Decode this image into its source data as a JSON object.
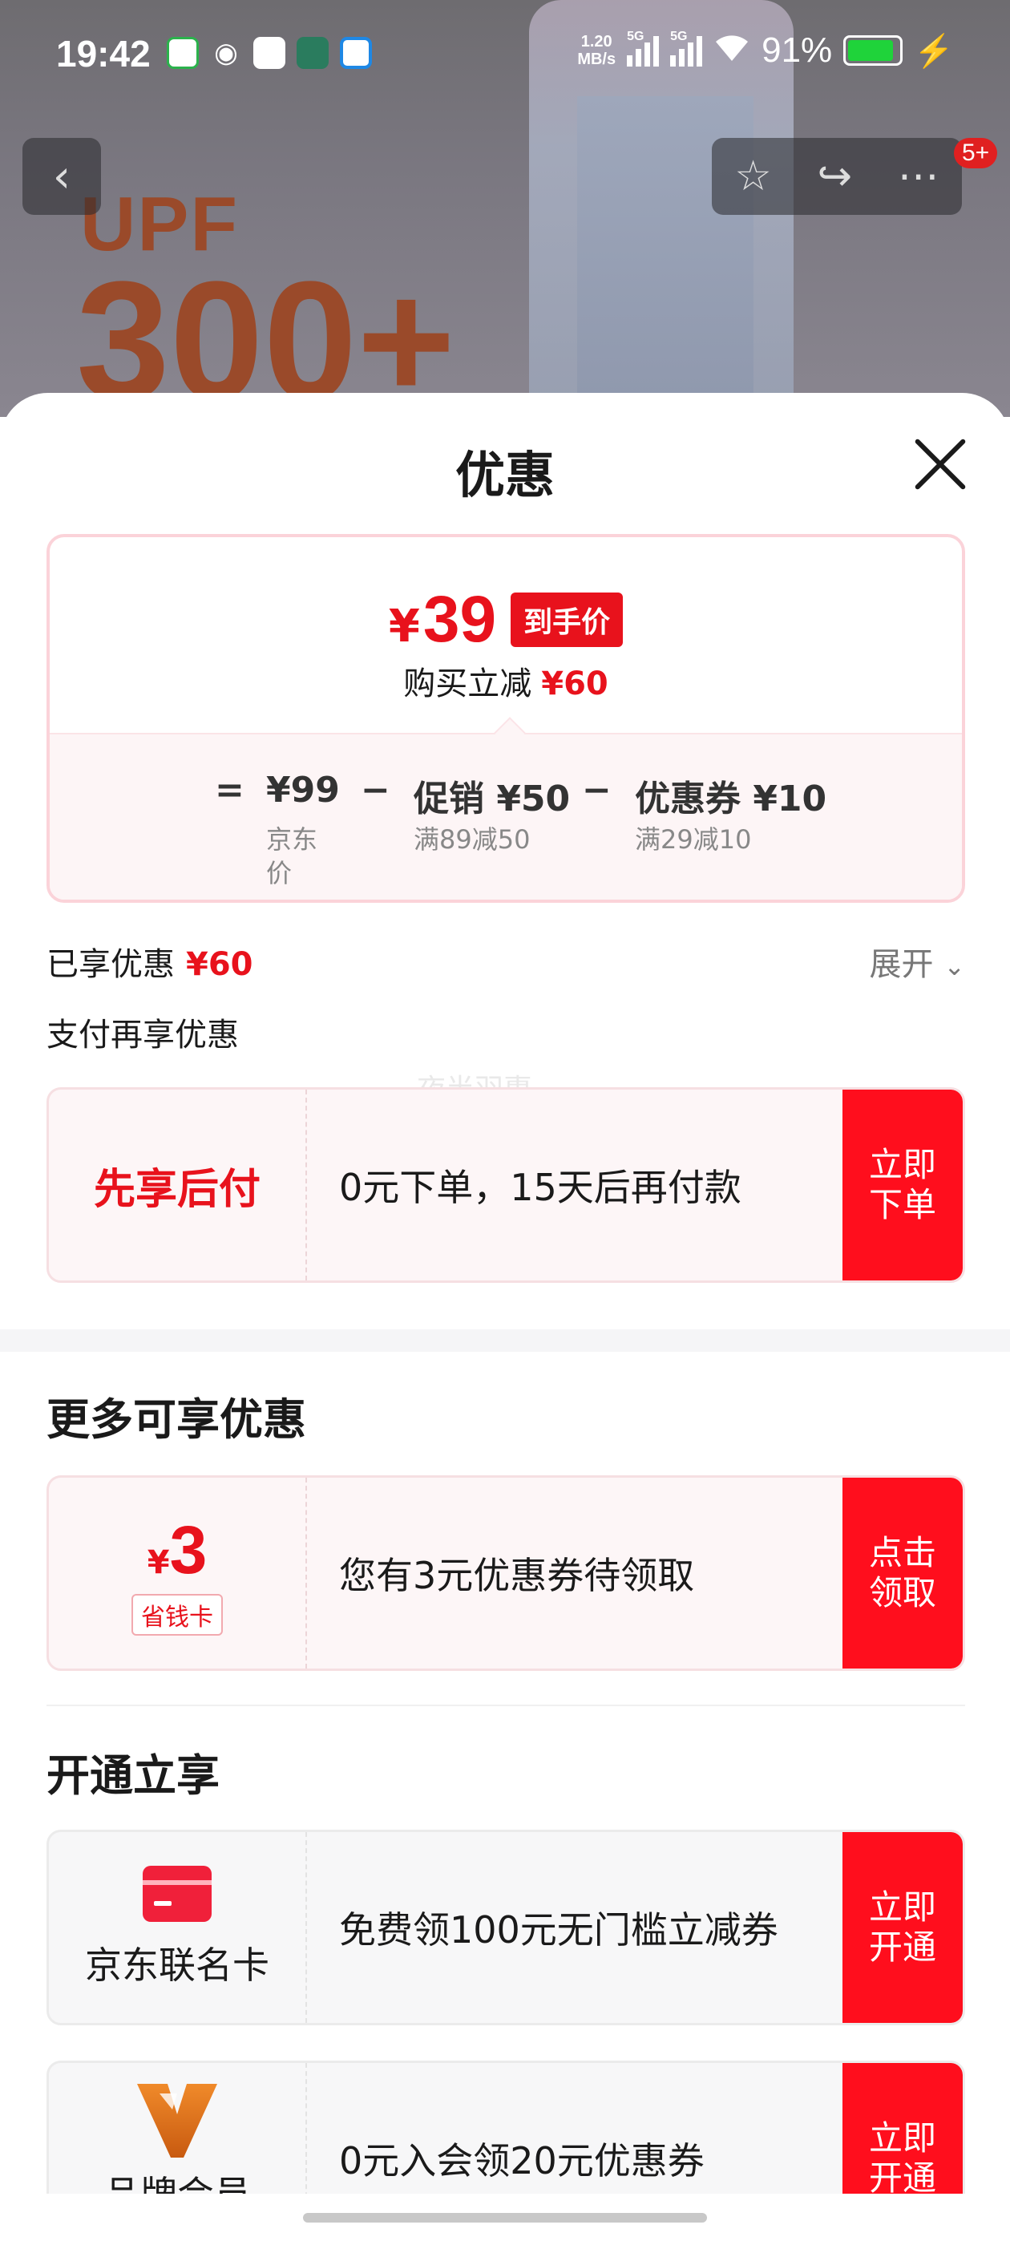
{
  "status_bar": {
    "time": "19:42",
    "net_speed_top": "1.20",
    "net_speed_bottom": "MB/s",
    "signal1_label": "5G",
    "signal2_label": "5G",
    "battery": "91%"
  },
  "background": {
    "upf_text": "UPF",
    "upf_value": "300+",
    "notification_badge": "5+"
  },
  "sheet": {
    "title": "优惠"
  },
  "price_card": {
    "currency": "¥",
    "final_price": "39",
    "price_tag": "到手价",
    "save_label": "购买立减",
    "save_amount": "¥60",
    "calc": {
      "equals": "=",
      "jd_price": "¥99",
      "jd_label_line1": "京东",
      "jd_label_line2": "价",
      "minus1": "−",
      "promo": "促销 ¥50",
      "promo_sub": "满89减50",
      "minus2": "−",
      "coupon": "优惠券 ¥10",
      "coupon_sub": "满29减10"
    }
  },
  "enjoyed": {
    "label": "已享优惠",
    "amount": "¥60",
    "expand": "展开"
  },
  "pay_more": {
    "title": "支付再享优惠",
    "watermark": "夜半羽惠",
    "offer": {
      "left": "先享后付",
      "text": "0元下单，15天后再付款",
      "btn_line1": "立即",
      "btn_line2": "下单"
    }
  },
  "more_offers": {
    "title": "更多可享优惠",
    "offer": {
      "currency": "¥",
      "value": "3",
      "tag": "省钱卡",
      "text": "您有3元优惠券待领取",
      "btn_line1": "点击",
      "btn_line2": "领取"
    }
  },
  "open_now": {
    "title": "开通立享",
    "card1": {
      "name": "京东联名卡",
      "text": "免费领100元无门槛立减券",
      "btn_line1": "立即",
      "btn_line2": "开通"
    },
    "card2": {
      "name": "品牌会员",
      "text": "0元入会领20元优惠券",
      "btn_line1": "立即",
      "btn_line2": "开通"
    }
  },
  "colors": {
    "accent_red": "#e8121c",
    "button_red": "#ff0e1d",
    "battery_green": "#1fd33a"
  }
}
